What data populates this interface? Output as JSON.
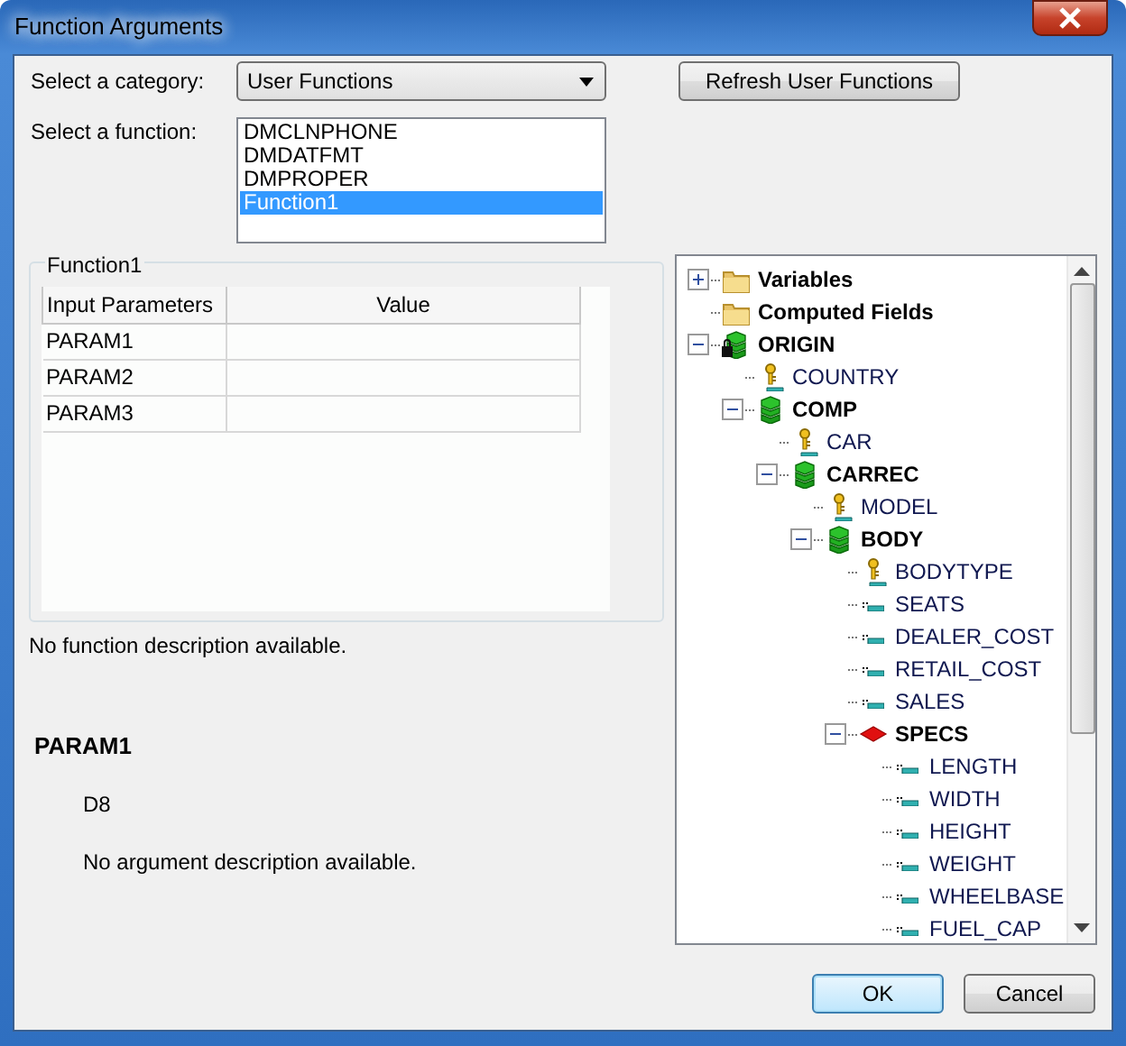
{
  "window": {
    "title": "Function Arguments"
  },
  "category": {
    "label": "Select a category:",
    "value": "User Functions"
  },
  "refresh_button": "Refresh User Functions",
  "function_list": {
    "label": "Select a function:",
    "items": [
      {
        "text": "DMCLNPHONE",
        "selected": false
      },
      {
        "text": "DMDATFMT",
        "selected": false
      },
      {
        "text": "DMPROPER",
        "selected": false
      },
      {
        "text": "Function1",
        "selected": true
      }
    ]
  },
  "group": {
    "title": "Function1",
    "columns": [
      "Input Parameters",
      "Value"
    ],
    "rows": [
      [
        "PARAM1",
        ""
      ],
      [
        "PARAM2",
        ""
      ],
      [
        "PARAM3",
        ""
      ]
    ]
  },
  "function_description": "No function description available.",
  "parameter": {
    "name": "PARAM1",
    "type": "D8",
    "description": "No argument description available."
  },
  "tree": [
    {
      "text": "Variables",
      "kind": "folder",
      "expanded": false
    },
    {
      "text": "Computed Fields",
      "kind": "folder"
    },
    {
      "text": "ORIGIN",
      "kind": "segment",
      "locked": true,
      "expanded": true,
      "children": [
        {
          "text": "COUNTRY",
          "kind": "key"
        },
        {
          "text": "COMP",
          "kind": "segment",
          "expanded": true,
          "children": [
            {
              "text": "CAR",
              "kind": "key"
            },
            {
              "text": "CARREC",
              "kind": "segment",
              "expanded": true,
              "children": [
                {
                  "text": "MODEL",
                  "kind": "key"
                },
                {
                  "text": "BODY",
                  "kind": "segment",
                  "expanded": true,
                  "children": [
                    {
                      "text": "BODYTYPE",
                      "kind": "key"
                    },
                    {
                      "text": "SEATS",
                      "kind": "field"
                    },
                    {
                      "text": "DEALER_COST",
                      "kind": "field"
                    },
                    {
                      "text": "RETAIL_COST",
                      "kind": "field"
                    },
                    {
                      "text": "SALES",
                      "kind": "field"
                    },
                    {
                      "text": "SPECS",
                      "kind": "specs",
                      "expanded": true,
                      "children": [
                        {
                          "text": "LENGTH",
                          "kind": "field"
                        },
                        {
                          "text": "WIDTH",
                          "kind": "field"
                        },
                        {
                          "text": "HEIGHT",
                          "kind": "field"
                        },
                        {
                          "text": "WEIGHT",
                          "kind": "field"
                        },
                        {
                          "text": "WHEELBASE",
                          "kind": "field"
                        },
                        {
                          "text": "FUEL_CAP",
                          "kind": "field"
                        }
                      ]
                    }
                  ]
                }
              ]
            }
          ]
        }
      ]
    }
  ],
  "buttons": [
    {
      "text": "OK",
      "default": true
    },
    {
      "text": "Cancel",
      "default": false
    }
  ]
}
